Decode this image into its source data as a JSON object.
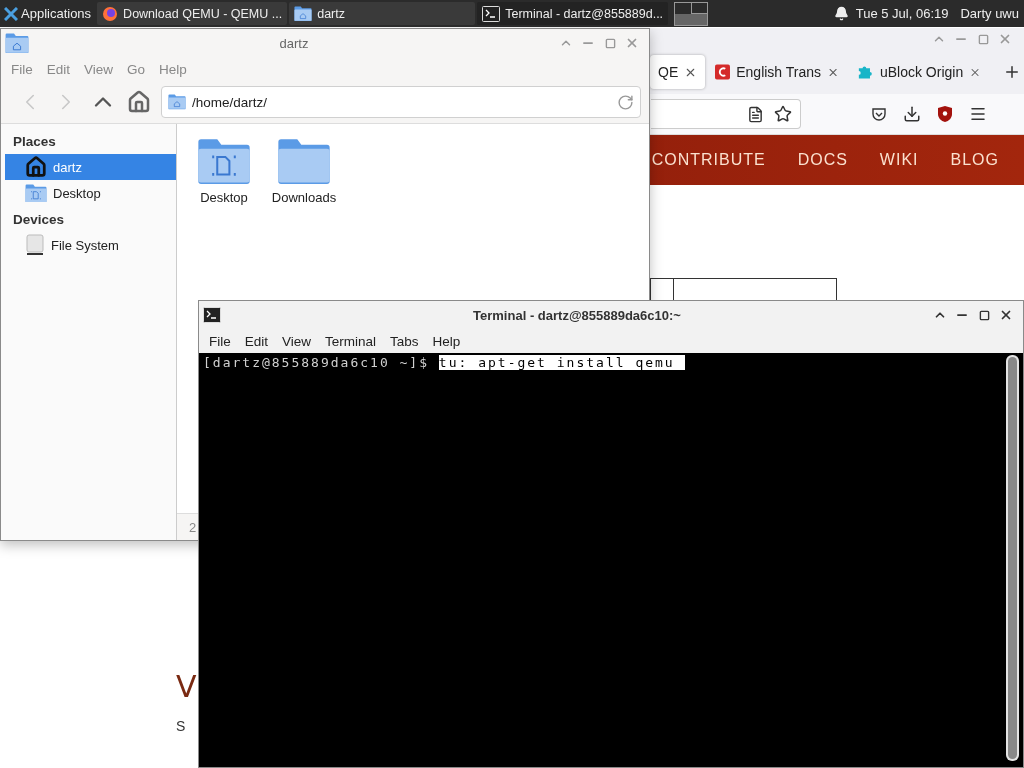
{
  "taskbar": {
    "menu_label": "Applications",
    "tasks": [
      {
        "title": "Download QEMU - QEMU ...",
        "kind": "browser",
        "selected": false
      },
      {
        "title": "dartz",
        "kind": "folder",
        "selected": false
      },
      {
        "title": "Terminal - dartz@855889d...",
        "kind": "terminal",
        "selected": true
      }
    ],
    "clock": "Tue  5 Jul, 06:19",
    "user": "Darty uwu"
  },
  "browser": {
    "tabs": [
      {
        "title": "QE",
        "kind": "plain",
        "selected": true
      },
      {
        "title": "English Trans",
        "kind": "letter",
        "selected": false
      },
      {
        "title": "uBlock Origin",
        "kind": "puzzle",
        "selected": false
      }
    ],
    "nav_links": [
      "CONTRIBUTE",
      "DOCS",
      "WIKI",
      "BLOG"
    ],
    "page": {
      "heading": "V",
      "text": "S"
    }
  },
  "file_manager": {
    "title": "dartz",
    "menu": [
      "File",
      "Edit",
      "View",
      "Go",
      "Help"
    ],
    "path": "/home/dartz/",
    "sidebar": [
      {
        "heading": "Places",
        "items": [
          {
            "label": "dartz",
            "kind": "home",
            "selected": true
          },
          {
            "label": "Desktop",
            "kind": "desktop",
            "selected": false
          }
        ]
      },
      {
        "heading": "Devices",
        "items": [
          {
            "label": "File System",
            "kind": "drive",
            "selected": false
          }
        ]
      }
    ],
    "files": [
      {
        "name": "Desktop",
        "kind": "desktop"
      },
      {
        "name": "Downloads",
        "kind": "folder"
      }
    ],
    "status": "2"
  },
  "terminal": {
    "title": "Terminal - dartz@855889da6c10:~",
    "menu": [
      "File",
      "Edit",
      "View",
      "Terminal",
      "Tabs",
      "Help"
    ],
    "prompt": "[dartz@855889da6c10 ~]$",
    "command": {
      "text": "tu: apt-get install qemu",
      "selected": true
    }
  }
}
